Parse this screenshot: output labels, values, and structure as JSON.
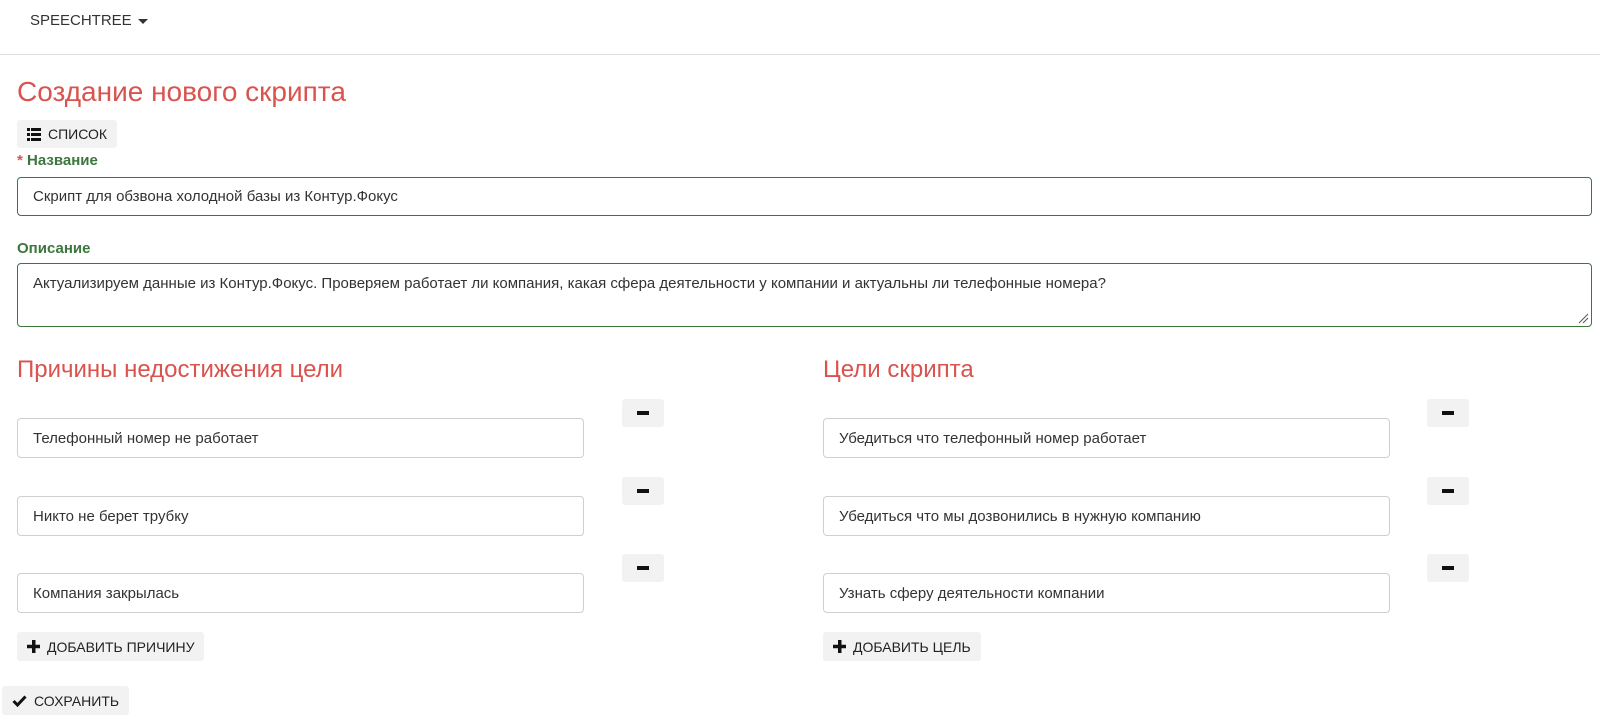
{
  "navbar": {
    "brand": "SPEECHTREE"
  },
  "page": {
    "title": "Создание нового скрипта"
  },
  "toolbar": {
    "list_label": "СПИСОК"
  },
  "form": {
    "name_label_required": "*",
    "name_label": "Название",
    "name_value": "Скрипт для обзвона холодной базы из Контур.Фокус",
    "description_label": "Описание",
    "description_value": "Актуализируем данные из Контур.Фокус. Проверяем работает ли компания, какая сфера деятельности у компании и актуальны ли телефонные номера?"
  },
  "reasons": {
    "title": "Причины недостижения цели",
    "items": [
      "Телефонный номер не работает",
      "Никто не берет трубку",
      "Компания закрылась"
    ],
    "add_label": "ДОБАВИТЬ ПРИЧИНУ"
  },
  "goals": {
    "title": "Цели скрипта",
    "items": [
      "Убедиться что телефонный номер работает",
      "Убедиться что мы дозвонились в нужную компанию",
      "Узнать сферу деятельности компании"
    ],
    "add_label": "ДОБАВИТЬ ЦЕЛЬ"
  },
  "actions": {
    "save_label": "СОХРАНИТЬ"
  },
  "colors": {
    "accent": "#d9534f",
    "label_green": "#3c763d",
    "button_bg": "#f2f2f2"
  }
}
